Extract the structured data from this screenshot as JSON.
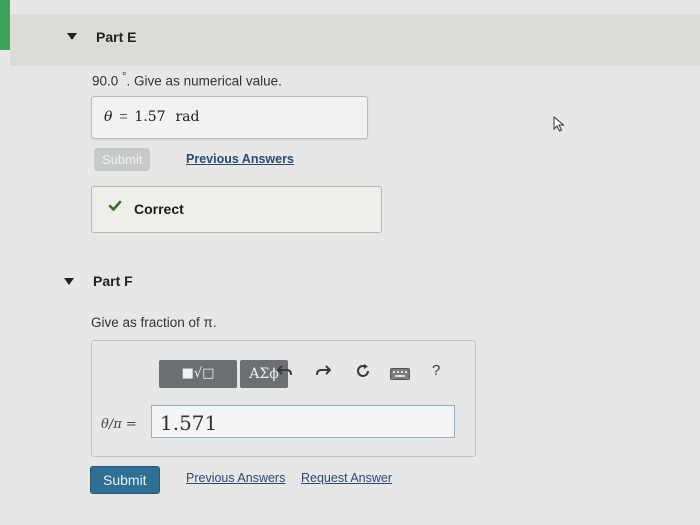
{
  "colors": {
    "accent": "#2f6e95",
    "success": "#3a6a2a",
    "disabled": "#c7cbc8"
  },
  "partE": {
    "title": "Part E",
    "prompt_value": "90.0",
    "prompt_degree": "°",
    "prompt_text": ". Give as numerical value.",
    "answer_var": "θ",
    "answer_eq": "=",
    "answer_value": "1.57",
    "answer_unit": "rad",
    "submit_label": "Submit",
    "previous_answers_label": "Previous Answers",
    "feedback_icon": "checkmark-icon",
    "feedback_label": "Correct"
  },
  "partF": {
    "title": "Part F",
    "prompt": "Give as fraction of π.",
    "toolbar": {
      "templates_icon": "math-templates-icon",
      "templates_label": "■√□",
      "symbols_label": "ΑΣϕ",
      "undo_icon": "undo-icon",
      "redo_icon": "redo-icon",
      "reset_icon": "reset-icon",
      "keyboard_icon": "keyboard-icon",
      "help_label": "?"
    },
    "input_label": "θ/π =",
    "input_value": "1.571",
    "submit_label": "Submit",
    "previous_answers_label": "Previous Answers",
    "request_answer_label": "Request Answer"
  }
}
